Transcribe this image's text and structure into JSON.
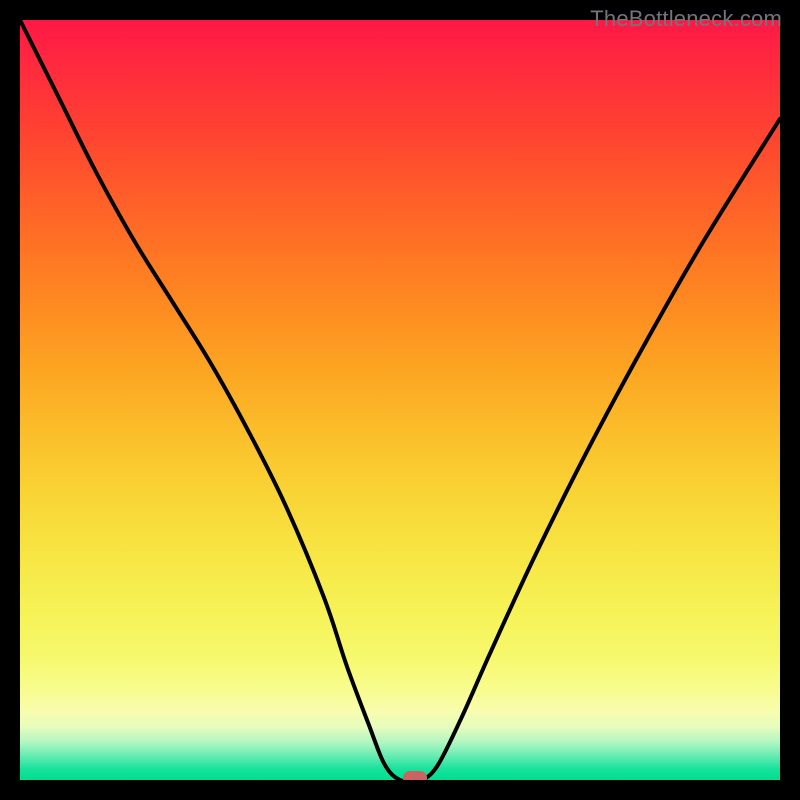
{
  "watermark": "TheBottleneck.com",
  "chart_data": {
    "type": "line",
    "title": "",
    "xlabel": "",
    "ylabel": "",
    "xlim": [
      0,
      100
    ],
    "ylim": [
      0,
      100
    ],
    "grid": false,
    "series": [
      {
        "name": "bottleneck-curve",
        "x": [
          0,
          5,
          10,
          15,
          20,
          25,
          30,
          35,
          40,
          43,
          46,
          48,
          50,
          52,
          53,
          55,
          58,
          62,
          68,
          75,
          82,
          90,
          100
        ],
        "y": [
          100,
          90,
          80,
          71,
          63,
          55,
          46,
          36,
          24,
          15,
          7,
          2,
          0,
          0,
          0,
          2,
          8,
          17,
          30,
          44,
          57,
          71,
          87
        ]
      }
    ],
    "background_gradient": {
      "stops": [
        "#FF1846",
        "#FCA522",
        "#F6F357",
        "#00DD92"
      ],
      "direction": "top-to-bottom"
    },
    "marker": {
      "x": 52,
      "y": 0,
      "color": "#CB6362",
      "label": "optimal-point"
    }
  }
}
